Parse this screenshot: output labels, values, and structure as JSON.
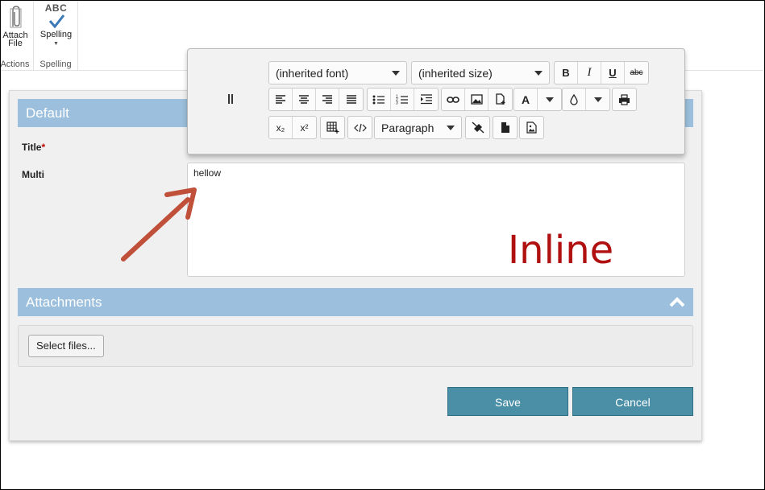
{
  "ribbon": {
    "groups": [
      {
        "label": "Actions",
        "button": {
          "label_line1": "Attach",
          "label_line2": "File",
          "icon": "paperclip-icon"
        }
      },
      {
        "label": "Spelling",
        "button": {
          "abc": "ABC",
          "label": "Spelling",
          "icon": "check-icon"
        }
      }
    ]
  },
  "toolbar": {
    "font_family": "(inherited font)",
    "font_size": "(inherited size)",
    "bold": "B",
    "italic": "I",
    "underline": "U",
    "strikethrough": "abc",
    "font_color": "A",
    "subscript": "x₂",
    "superscript": "x²",
    "block_format": "Paragraph"
  },
  "form": {
    "section_default": "Default",
    "title_label": "Title",
    "title_required_mark": "*",
    "multi_label": "Multi",
    "multi_value": "hellow",
    "annotation": "Inline",
    "section_attachments": "Attachments",
    "select_files": "Select files...",
    "save": "Save",
    "cancel": "Cancel"
  },
  "colors": {
    "section_header": "#9bbfdc",
    "action_button": "#4a8fa6",
    "annotation": "#b01010",
    "arrow": "#c0503a"
  }
}
